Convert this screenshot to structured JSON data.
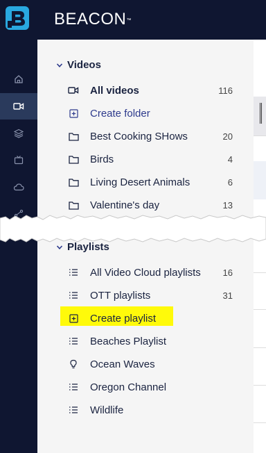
{
  "brand": {
    "name": "BEACON",
    "trademark": "™"
  },
  "rail": {
    "icons": [
      "home-icon",
      "video-camera-icon",
      "layers-icon",
      "tv-icon",
      "cloud-icon",
      "share-icon"
    ],
    "active_index": 1
  },
  "videos": {
    "title": "Videos",
    "items": [
      {
        "label": "All videos",
        "count": "116",
        "icon": "video-camera-icon",
        "bold": true
      },
      {
        "label": "Create folder",
        "count": "",
        "icon": "plus-square-icon",
        "link": true
      },
      {
        "label": "Best Cooking SHows",
        "count": "20",
        "icon": "folder-icon"
      },
      {
        "label": "Birds",
        "count": "4",
        "icon": "folder-icon"
      },
      {
        "label": "Living Desert Animals",
        "count": "6",
        "icon": "folder-icon"
      },
      {
        "label": "Valentine's day",
        "count": "13",
        "icon": "folder-icon"
      }
    ]
  },
  "playlists": {
    "title": "Playlists",
    "items": [
      {
        "label": "All Video Cloud playlists",
        "count": "16",
        "icon": "list-icon"
      },
      {
        "label": "OTT playlists",
        "count": "31",
        "icon": "list-icon"
      },
      {
        "label": "Create playlist",
        "count": "",
        "icon": "plus-square-icon",
        "highlighted": true
      },
      {
        "label": "Beaches Playlist",
        "count": "",
        "icon": "list-icon"
      },
      {
        "label": "Ocean Waves",
        "count": "",
        "icon": "lightbulb-icon"
      },
      {
        "label": "Oregon Channel",
        "count": "",
        "icon": "list-icon"
      },
      {
        "label": "Wildlife",
        "count": "",
        "icon": "list-icon"
      }
    ]
  },
  "colors": {
    "navy": "#0f1631",
    "accent": "#29a8e0",
    "highlight": "#fffa0a",
    "link": "#2d3a8c"
  }
}
